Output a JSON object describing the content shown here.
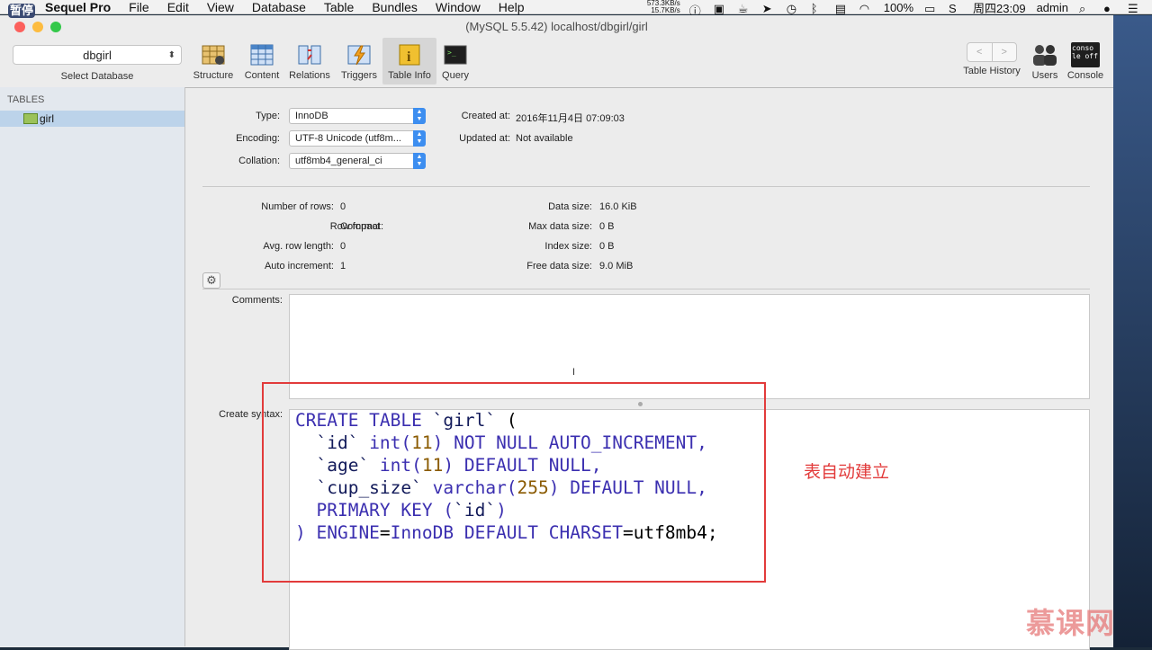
{
  "menubar": {
    "app_name": "Sequel Pro",
    "items": [
      "File",
      "Edit",
      "View",
      "Database",
      "Table",
      "Bundles",
      "Window",
      "Help"
    ],
    "net_up": "573.3KB/s",
    "net_down": "15.7KB/s",
    "battery": "100%",
    "clock": "周四23:09",
    "user": "admin",
    "pause_badge": "暂停"
  },
  "window": {
    "title": "(MySQL 5.5.42) localhost/dbgirl/girl",
    "colors": {
      "close": "#fc605c",
      "minimize": "#fdbc40",
      "zoom": "#34c84a"
    }
  },
  "toolbar": {
    "database_value": "dbgirl",
    "database_label": "Select Database",
    "structure": "Structure",
    "content": "Content",
    "relations": "Relations",
    "triggers": "Triggers",
    "table_info": "Table Info",
    "query": "Query",
    "table_history": "Table History",
    "users": "Users",
    "console": "Console",
    "console_icon_text": "conso le off"
  },
  "sidebar": {
    "heading": "TABLES",
    "items": [
      {
        "label": "girl"
      }
    ]
  },
  "info": {
    "type_label": "Type:",
    "type_value": "InnoDB",
    "encoding_label": "Encoding:",
    "encoding_value": "UTF-8 Unicode (utf8m...",
    "collation_label": "Collation:",
    "collation_value": "utf8mb4_general_ci",
    "created_label": "Created at:",
    "created_value": "2016年11月4日 07:09:03",
    "updated_label": "Updated at:",
    "updated_value": "Not available"
  },
  "stats": {
    "rows_label": "Number of rows:",
    "rows_value": "0",
    "format_label": "Row format:",
    "format_value": "Compact",
    "avg_label": "Avg. row length:",
    "avg_value": "0",
    "autoinc_label": "Auto increment:",
    "autoinc_value": "1",
    "data_size_label": "Data size:",
    "data_size_value": "16.0 KiB",
    "max_data_label": "Max data size:",
    "max_data_value": "0 B",
    "index_label": "Index size:",
    "index_value": "0 B",
    "free_label": "Free data size:",
    "free_value": "9.0 MiB"
  },
  "comments_label": "Comments:",
  "comments_value": "",
  "create_syntax_label": "Create syntax:",
  "sql_tokens": {
    "l1a": "CREATE TABLE ",
    "l1b": "`girl`",
    "l1c": " (",
    "l2a": "  `id` ",
    "l2b": "int(",
    "l2c": "11",
    "l2d": ") NOT NULL AUTO_INCREMENT,",
    "l3a": "  `age` ",
    "l3b": "int(",
    "l3c": "11",
    "l3d": ") DEFAULT NULL,",
    "l4a": "  `cup_size` ",
    "l4b": "varchar(",
    "l4c": "255",
    "l4d": ") DEFAULT NULL,",
    "l5a": "  PRIMARY KEY (",
    "l5b": "`id`",
    "l5c": ")",
    "l6a": ") ENGINE",
    "l6b": "=",
    "l6c": "InnoDB DEFAULT CHARSET",
    "l6d": "=utf8mb4;"
  },
  "annotation": "表自动建立",
  "watermark": "慕课网",
  "colors": {
    "annotation": "#e23b3b",
    "accent": "#3d8ef0"
  }
}
